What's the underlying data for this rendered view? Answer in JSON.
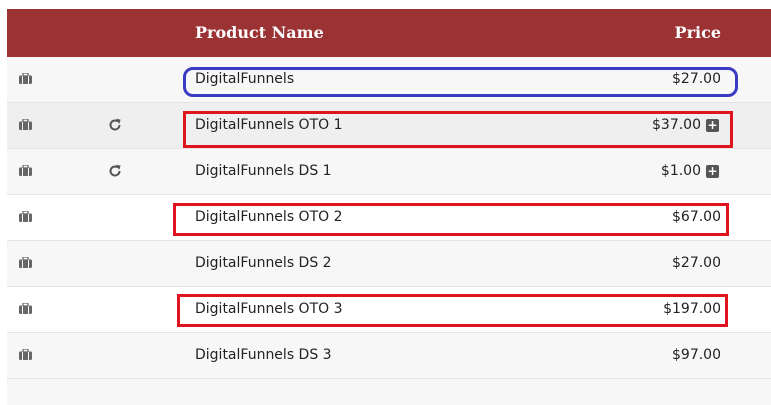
{
  "header": {
    "product_name": "Product Name",
    "price": "Price"
  },
  "rows": [
    {
      "name": "DigitalFunnels",
      "price": "$27.00",
      "refresh": false,
      "plus": false
    },
    {
      "name": "DigitalFunnels OTO 1",
      "price": "$37.00",
      "refresh": true,
      "plus": true
    },
    {
      "name": "DigitalFunnels DS 1",
      "price": "$1.00",
      "refresh": true,
      "plus": true
    },
    {
      "name": "DigitalFunnels OTO 2",
      "price": "$67.00",
      "refresh": false,
      "plus": false
    },
    {
      "name": "DigitalFunnels DS 2",
      "price": "$27.00",
      "refresh": false,
      "plus": false
    },
    {
      "name": "DigitalFunnels OTO 3",
      "price": "$197.00",
      "refresh": false,
      "plus": false
    },
    {
      "name": "DigitalFunnels DS 3",
      "price": "$97.00",
      "refresh": false,
      "plus": false
    }
  ],
  "icons": {
    "row_icon": "briefcase-icon",
    "refresh_icon": "refresh-icon",
    "expand_icon": "plus-square-icon"
  },
  "colors": {
    "header_bg": "#9b3335",
    "annotation_blue": "#3a3bc2",
    "annotation_red": "#e0141e"
  }
}
